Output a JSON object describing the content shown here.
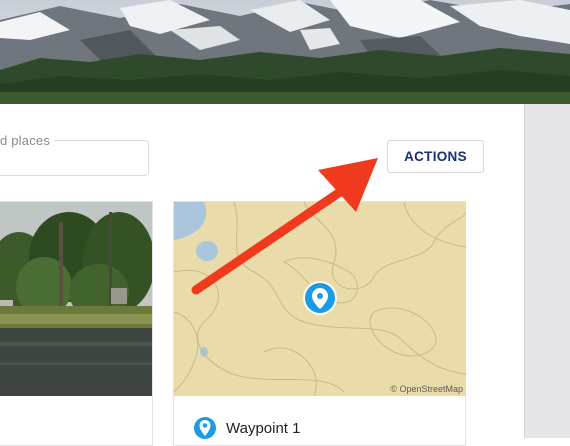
{
  "hero": {
    "image": "mountain-landscape"
  },
  "search": {
    "label": "d places",
    "value": ""
  },
  "toolbar": {
    "actions_label": "ACTIONS"
  },
  "cards": [
    {
      "type": "photo",
      "image": "lake-forest-photo"
    },
    {
      "type": "map",
      "attribution": "© OpenStreetMap",
      "waypoint_label": "Waypoint 1"
    }
  ],
  "annotation": {
    "icon": "red-arrow-icon",
    "color": "#f03a1e"
  },
  "colors": {
    "accent": "#17307a",
    "pin": "#1a9be6",
    "map_bg": "#eadcaa",
    "side_panel": "#e6e6ea"
  }
}
